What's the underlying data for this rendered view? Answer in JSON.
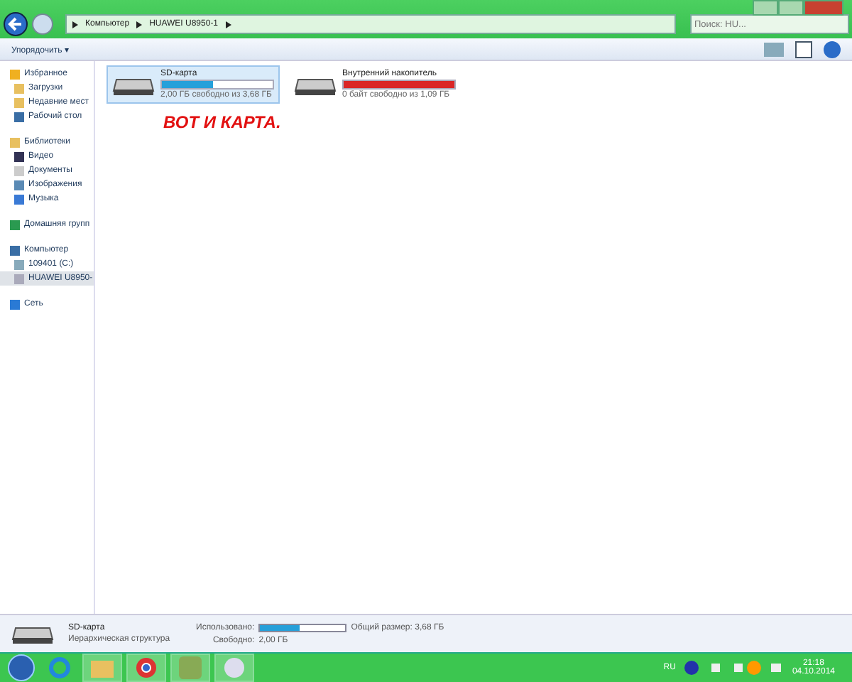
{
  "address": {
    "crumbs": [
      "Компьютер",
      "HUAWEI U8950-1"
    ],
    "search_placeholder": "Поиск: HU..."
  },
  "toolbar": {
    "organize": "Упорядочить ▾"
  },
  "sidebar": {
    "groups": [
      {
        "label": "Избранное",
        "children": [
          {
            "label": "Загрузки",
            "selected": false
          },
          {
            "label": "Недавние мест",
            "selected": false
          },
          {
            "label": "Рабочий стол",
            "selected": false
          }
        ]
      },
      {
        "label": "Библиотеки",
        "children": [
          {
            "label": "Видео",
            "selected": false
          },
          {
            "label": "Документы",
            "selected": false
          },
          {
            "label": "Изображения",
            "selected": false
          },
          {
            "label": "Музыка",
            "selected": false
          }
        ]
      },
      {
        "label": "Домашняя групп"
      },
      {
        "label": "Компьютер",
        "children": [
          {
            "label": "109401 (C:)",
            "selected": false
          },
          {
            "label": "HUAWEI U8950-",
            "selected": true
          }
        ]
      },
      {
        "label": "Сеть"
      }
    ]
  },
  "drives": [
    {
      "name": "SD-карта",
      "free": "2,00 ГБ свободно из 3,68 ГБ",
      "level": 0.46,
      "color": "#26a0da",
      "selected": true
    },
    {
      "name": "Внутренний накопитель",
      "free": "0 байт свободно из 1,09 ГБ",
      "level": 1,
      "color": "#da2626",
      "selected": false
    }
  ],
  "annotation": "ВОТ И КАРТА.",
  "details": {
    "name": "SD-карта",
    "type": "Иерархическая структура",
    "used_label": "Использовано:",
    "level": 0.46,
    "total": "Общий размер: 3,68 ГБ",
    "free_label": "Свободно:",
    "free": "2,00 ГБ"
  },
  "taskbar": {
    "lang": "RU",
    "time": "21:18",
    "date": "04.10.2014"
  }
}
